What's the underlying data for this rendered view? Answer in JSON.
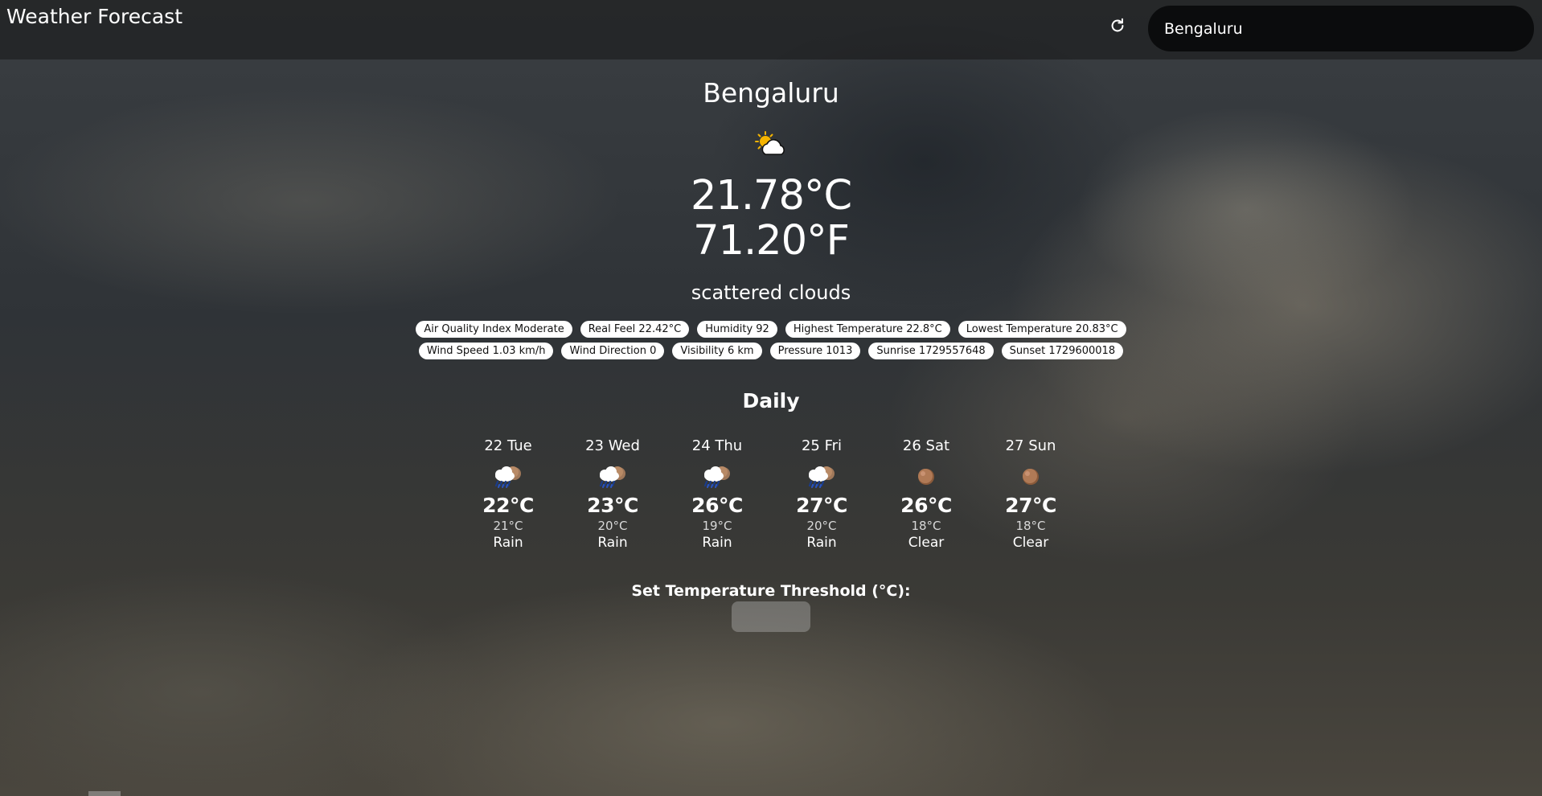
{
  "header": {
    "app_title": "Weather Forecast",
    "search_value": "Bengaluru",
    "refresh_icon": "refresh-icon"
  },
  "current": {
    "city": "Bengaluru",
    "icon": "few-clouds-day-icon",
    "temp_c": "21.78°C",
    "temp_f": "71.20°F",
    "description": "scattered clouds"
  },
  "details_row1": [
    "Air Quality Index Moderate",
    "Real Feel 22.42°C",
    "Humidity 92",
    "Highest Temperature 22.8°C",
    "Lowest Temperature 20.83°C"
  ],
  "details_row2": [
    "Wind Speed 1.03 km/h",
    "Wind Direction 0",
    "Visibility 6 km",
    "Pressure 1013",
    "Sunrise 1729557648",
    "Sunset 1729600018"
  ],
  "daily": {
    "title": "Daily",
    "days": [
      {
        "name": "22 Tue",
        "icon": "rain-night-icon",
        "max": "22°C",
        "min": "21°C",
        "cond": "Rain"
      },
      {
        "name": "23 Wed",
        "icon": "rain-night-icon",
        "max": "23°C",
        "min": "20°C",
        "cond": "Rain"
      },
      {
        "name": "24 Thu",
        "icon": "rain-night-icon",
        "max": "26°C",
        "min": "19°C",
        "cond": "Rain"
      },
      {
        "name": "25 Fri",
        "icon": "rain-night-icon",
        "max": "27°C",
        "min": "20°C",
        "cond": "Rain"
      },
      {
        "name": "26 Sat",
        "icon": "clear-night-icon",
        "max": "26°C",
        "min": "18°C",
        "cond": "Clear"
      },
      {
        "name": "27 Sun",
        "icon": "clear-night-icon",
        "max": "27°C",
        "min": "18°C",
        "cond": "Clear"
      }
    ]
  },
  "threshold": {
    "label": "Set Temperature Threshold (°C):",
    "value": ""
  }
}
